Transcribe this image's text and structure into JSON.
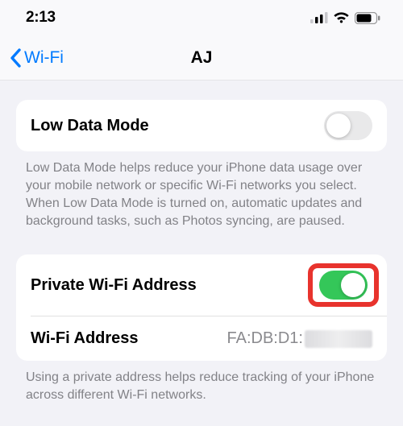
{
  "status": {
    "time": "2:13"
  },
  "nav": {
    "back_label": "Wi-Fi",
    "title": "AJ"
  },
  "groups": {
    "low_data": {
      "label": "Low Data Mode",
      "footer": "Low Data Mode helps reduce your iPhone data usage over your mobile network or specific Wi-Fi networks you select. When Low Data Mode is turned on, automatic updates and background tasks, such as Photos syncing, are paused."
    },
    "private": {
      "private_label": "Private Wi-Fi Address",
      "address_label": "Wi-Fi Address",
      "address_value": "FA:DB:D1:",
      "footer": "Using a private address helps reduce tracking of your iPhone across different Wi-Fi networks."
    }
  },
  "toggles": {
    "low_data_mode": false,
    "private_wifi_address": true
  }
}
